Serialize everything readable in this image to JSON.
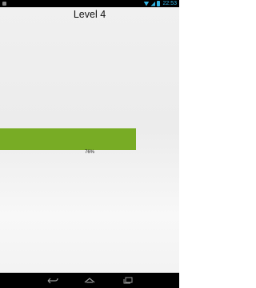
{
  "status_bar": {
    "time": "22:53",
    "icons": [
      "notification-icon",
      "wifi-icon",
      "signal-icon",
      "battery-icon"
    ],
    "accent_color": "#33b5e5"
  },
  "main": {
    "title": "Level 4",
    "progress": {
      "value_percent": 76,
      "label": "76%",
      "color": "#78ac25"
    }
  },
  "nav_bar": {
    "buttons": [
      "back-icon",
      "home-icon",
      "recents-icon"
    ]
  }
}
